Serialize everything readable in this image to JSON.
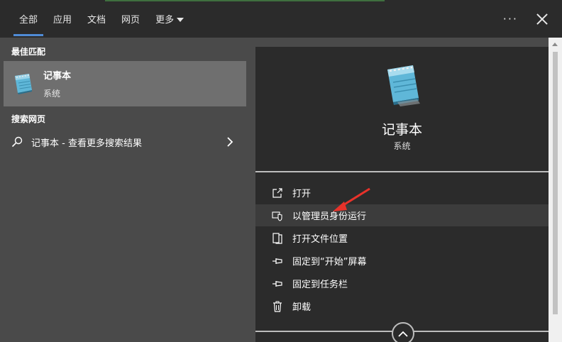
{
  "header": {
    "tabs": [
      {
        "label": "全部",
        "active": true
      },
      {
        "label": "应用",
        "active": false
      },
      {
        "label": "文档",
        "active": false
      },
      {
        "label": "网页",
        "active": false
      },
      {
        "label": "更多",
        "active": false,
        "dropdown": true
      }
    ],
    "more_options_label": "···"
  },
  "left": {
    "best_match_title": "最佳匹配",
    "best_match": {
      "name": "记事本",
      "type": "系统",
      "icon": "notepad-icon"
    },
    "web_title": "搜索网页",
    "web_result": {
      "text": "记事本 - 查看更多搜索结果",
      "icon": "search-icon"
    }
  },
  "detail": {
    "name": "记事本",
    "type": "系统",
    "actions": [
      {
        "label": "打开",
        "icon": "open-icon"
      },
      {
        "label": "以管理员身份运行",
        "icon": "admin-shield-icon"
      },
      {
        "label": "打开文件位置",
        "icon": "file-location-icon"
      },
      {
        "label": "固定到“开始”屏幕",
        "icon": "pin-icon"
      },
      {
        "label": "固定到任务栏",
        "icon": "pin-icon"
      },
      {
        "label": "卸载",
        "icon": "trash-icon"
      }
    ]
  },
  "colors": {
    "accent": "#4f8bd6",
    "annotation": "#e8322a",
    "selection": "#6f6f6f"
  }
}
